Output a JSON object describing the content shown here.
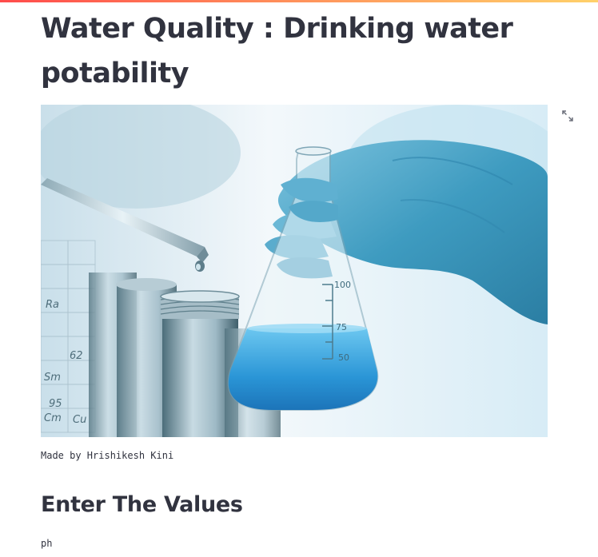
{
  "page": {
    "title": "Water Quality : Drinking water potability",
    "image": {
      "description_icon": "lab-flask-photo",
      "alt": "",
      "flask_marks": [
        "100",
        "75",
        "50"
      ],
      "periodic_labels": [
        "Sm",
        "95",
        "62",
        "Cm",
        "Ra",
        "Cu"
      ]
    },
    "fullscreen_icon": "expand-icon",
    "caption": "Made by Hrishikesh Kini",
    "subheader": "Enter The Values",
    "inputs": [
      {
        "label": "ph"
      }
    ]
  },
  "colors": {
    "accent_gradient_start": "#ff4b4b",
    "accent_gradient_end": "#ffd16a",
    "text": "#31333f",
    "glove": "#4aa7c9",
    "water": "#2f9fdc"
  }
}
